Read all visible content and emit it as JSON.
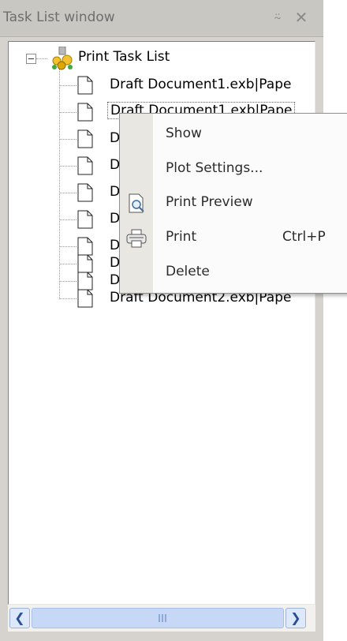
{
  "window": {
    "title": "Task List window",
    "pin_glyph": "⍨",
    "close_glyph": "✕"
  },
  "tree": {
    "root": {
      "label": "Print Task List",
      "icon": "print-task-list-icon",
      "expanded": true
    },
    "items": [
      {
        "label": "Draft Document1.exb|Pape",
        "icon": "document-icon",
        "selected": false
      },
      {
        "label": "Draft Document1.exb|Pape",
        "icon": "document-icon",
        "selected": true
      },
      {
        "label": "D",
        "icon": "document-icon",
        "selected": false
      },
      {
        "label": "D",
        "icon": "document-icon",
        "selected": false
      },
      {
        "label": "D",
        "icon": "document-icon",
        "selected": false
      },
      {
        "label": "D",
        "icon": "document-icon",
        "selected": false
      },
      {
        "label": "D",
        "icon": "document-icon",
        "selected": false
      },
      {
        "label": "D",
        "icon": "document-icon",
        "selected": false
      },
      {
        "label": "D",
        "icon": "document-icon",
        "selected": false
      },
      {
        "label": "Draft Document2.exb|Pape",
        "icon": "document-icon",
        "selected": false
      }
    ]
  },
  "context_menu": {
    "items": [
      {
        "label": "Show",
        "shortcut": "",
        "icon": ""
      },
      {
        "label": "Plot Settings...",
        "shortcut": "",
        "icon": ""
      },
      {
        "label": "Print Preview",
        "shortcut": "",
        "icon": "print-preview-icon"
      },
      {
        "label": "Print",
        "shortcut": "Ctrl+P",
        "icon": "printer-icon"
      },
      {
        "label": "Delete",
        "shortcut": "",
        "icon": ""
      }
    ]
  },
  "scrollbar": {
    "left_glyph": "❮",
    "right_glyph": "❯"
  },
  "colors": {
    "panel": "#d6d3ce",
    "menu_gutter": "#e9e7e2",
    "scroll_thumb": "#c7d8f7"
  }
}
